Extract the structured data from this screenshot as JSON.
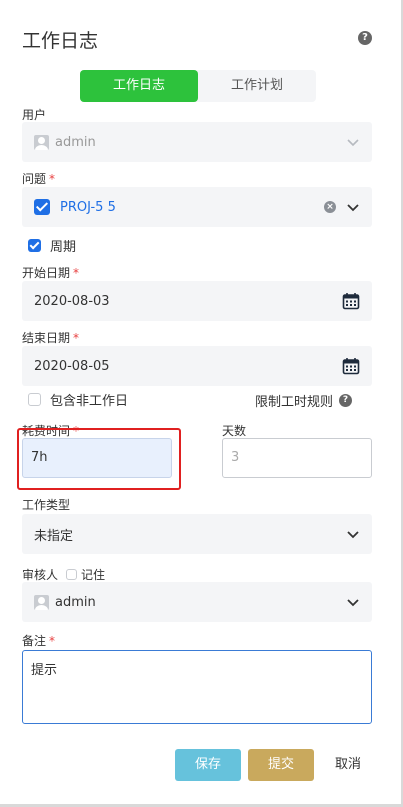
{
  "dialog": {
    "title": "工作日志"
  },
  "tabs": [
    {
      "label": "工作日志",
      "active": true
    },
    {
      "label": "工作计划",
      "active": false
    }
  ],
  "user": {
    "label": "用户",
    "value": "admin"
  },
  "issue": {
    "label": "问题",
    "required_mark": "*",
    "value": "PROJ-5  5"
  },
  "period": {
    "label": "周期",
    "checked": true
  },
  "start_date": {
    "label": "开始日期",
    "required_mark": "*",
    "value": "2020-08-03"
  },
  "end_date": {
    "label": "结束日期",
    "required_mark": "*",
    "value": "2020-08-05"
  },
  "include_non_working": {
    "label": "包含非工作日",
    "checked": false
  },
  "limit_rule": {
    "label": "限制工时规则"
  },
  "time_spent": {
    "label": "耗费时间",
    "required_mark": "*",
    "value": "7h"
  },
  "days": {
    "label": "天数",
    "value": "3"
  },
  "work_type": {
    "label": "工作类型",
    "value": "未指定"
  },
  "reviewer": {
    "label": "审核人",
    "remember_label": "记住",
    "remember_checked": false,
    "value": "admin"
  },
  "remark": {
    "label": "备注",
    "required_mark": "*",
    "value": "提示"
  },
  "buttons": {
    "save": "保存",
    "submit": "提交",
    "cancel": "取消"
  },
  "colors": {
    "tab_active": "#2dc23c",
    "checkbox": "#1f6fe5",
    "save": "#66c2dc",
    "submit": "#c9a95d",
    "highlight": "#e02020"
  }
}
